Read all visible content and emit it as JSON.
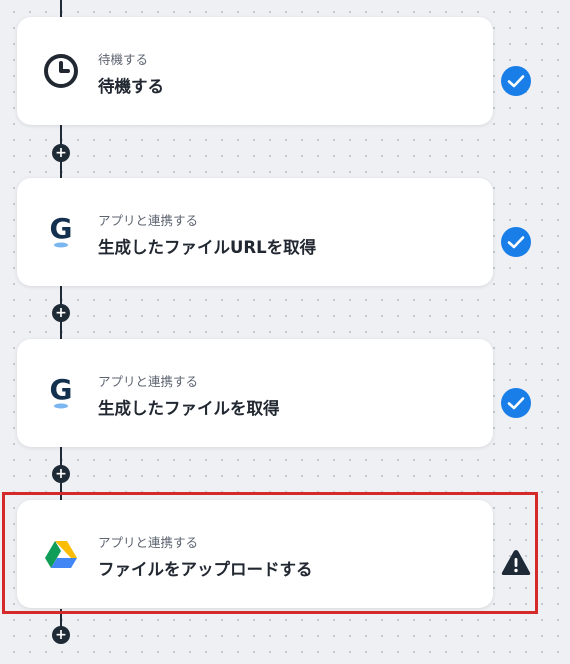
{
  "steps": [
    {
      "subtitle": "待機する",
      "title": "待機する",
      "icon": "clock-icon",
      "status": "completed"
    },
    {
      "subtitle": "アプリと連携する",
      "title": "生成したファイルURLを取得",
      "icon": "g-app-icon",
      "status": "completed"
    },
    {
      "subtitle": "アプリと連携する",
      "title": "生成したファイルを取得",
      "icon": "g-app-icon",
      "status": "completed"
    },
    {
      "subtitle": "アプリと連携する",
      "title": "ファイルをアップロードする",
      "icon": "google-drive-icon",
      "status": "warning"
    }
  ],
  "add_step_symbol": "+",
  "colors": {
    "check": "#1a7ee8",
    "warning": "#1f2a37",
    "highlight_border": "#d42a2a",
    "connector": "#1f2a37"
  }
}
